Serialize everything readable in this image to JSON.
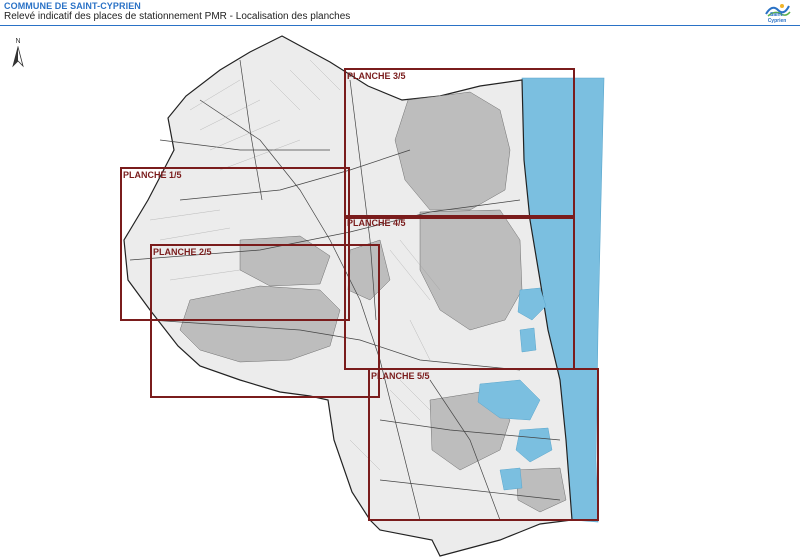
{
  "header": {
    "title": "COMMUNE DE SAINT-CYPRIEN",
    "subtitle": "Relevé indicatif des places de stationnement PMR - Localisation des planches",
    "logo_text": "Saint-Cyprien",
    "accent_color": "#2a72c6"
  },
  "north_arrow": {
    "label": "N",
    "icon": "north-arrow-icon"
  },
  "map": {
    "land_color": "#ececec",
    "sea_color": "#7bbfe0",
    "planche_color": "#7a1c1c",
    "planches": [
      {
        "label": "PLANCHE 1/5"
      },
      {
        "label": "PLANCHE 2/5"
      },
      {
        "label": "PLANCHE 3/5"
      },
      {
        "label": "PLANCHE 4/5"
      },
      {
        "label": "PLANCHE 5/5"
      }
    ]
  }
}
